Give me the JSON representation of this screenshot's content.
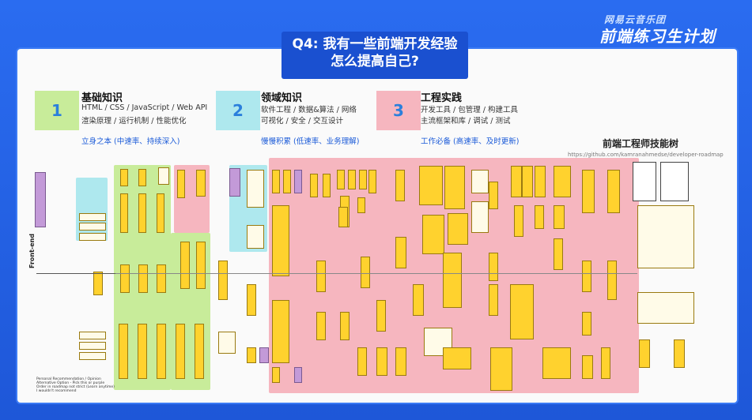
{
  "header": {
    "title_line1": "Q4: 我有一些前端开发经验",
    "title_line2": "怎么提高自己?",
    "brand_small": "网易云音乐团",
    "brand_big": "前端练习生计划"
  },
  "sections": [
    {
      "num": "1",
      "title": "基础知识",
      "line1": "HTML / CSS / JavaScript / Web API",
      "line2": "渲染原理 / 运行机制 / 性能优化",
      "tag": "立身之本 (中速率、持续深入)",
      "color": "#c8ec9a",
      "numColor": "#2a7fdc"
    },
    {
      "num": "2",
      "title": "领域知识",
      "line1": "软件工程 / 数据&算法 / 网络",
      "line2": "可视化 / 安全 / 交互设计",
      "tag": "慢慢积累 (低速率、业务理解)",
      "color": "#aee8ee",
      "numColor": "#2a7fdc"
    },
    {
      "num": "3",
      "title": "工程实践",
      "line1": "开发工具 / 包管理 / 构建工具",
      "line2": "主流框架和库 / 调试 / 测试",
      "tag": "工作必备 (高速率、及时更新)",
      "color": "#f6b6bf",
      "numColor": "#2a7fdc"
    }
  ],
  "tree": {
    "title": "前端工程师技能树",
    "url": "https://github.com/kamranahmedse/developer-roadmap",
    "side_label": "Front-end",
    "legend": [
      "Personal Recommendation / Opinion",
      "Alternative Option - Pick this or purple",
      "Order in roadmap not strict (Learn anytime)",
      "I wouldn't recommend"
    ]
  },
  "colors": {
    "green": "#c8ec9a",
    "cyan": "#aee8ee",
    "pink": "#f6b6bf",
    "node": "#ffd22e",
    "purple": "#c39ad8"
  }
}
